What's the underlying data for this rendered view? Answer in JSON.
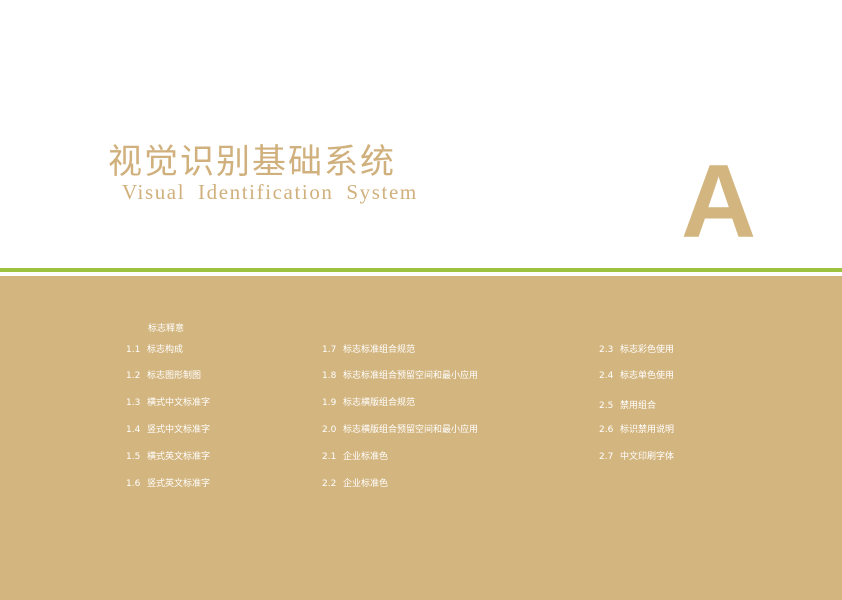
{
  "header": {
    "title_cn": "视觉识别基础系统",
    "title_en": "Visual Identification System",
    "section_letter": "A"
  },
  "toc": {
    "heading": "标志释意",
    "items": [
      {
        "num": "1.1",
        "label": "标志构成"
      },
      {
        "num": "1.2",
        "label": "标志图形制图"
      },
      {
        "num": "1.3",
        "label": "横式中文标准字"
      },
      {
        "num": "1.4",
        "label": "竖式中文标准字"
      },
      {
        "num": "1.5",
        "label": "横式英文标准字"
      },
      {
        "num": "1.6",
        "label": "竖式英文标准字"
      },
      {
        "num": "1.7",
        "label": "标志标准组合规范"
      },
      {
        "num": "1.8",
        "label": "标志标准组合预留空间和最小应用"
      },
      {
        "num": "1.9",
        "label": "标志横版组合规范"
      },
      {
        "num": "2.0",
        "label": "标志横版组合预留空间和最小应用"
      },
      {
        "num": "2.1",
        "label": "企业标准色"
      },
      {
        "num": "2.2",
        "label": "企业标准色"
      },
      {
        "num": "2.3",
        "label": "标志彩色使用"
      },
      {
        "num": "2.4",
        "label": "标志单色使用"
      },
      {
        "num": "2.5",
        "label": "禁用组合"
      },
      {
        "num": "2.6",
        "label": "标识禁用说明"
      },
      {
        "num": "2.7",
        "label": "中文印刷字体"
      }
    ]
  },
  "colors": {
    "gold": "#d3b57f",
    "title_gold": "#d0b07c",
    "green_divider": "#9dc240",
    "white": "#ffffff"
  }
}
